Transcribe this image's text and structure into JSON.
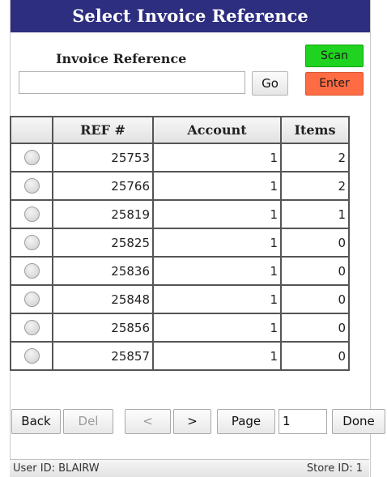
{
  "title": "Select Invoice Reference",
  "invoice": {
    "label": "Invoice Reference",
    "value": "",
    "go_label": "Go",
    "scan_label": "Scan",
    "enter_label": "Enter"
  },
  "colors": {
    "title_bar": "#2d2e80",
    "scan_button": "#21d321",
    "enter_button": "#ff6b43"
  },
  "table": {
    "headers": [
      "",
      "REF #",
      "Account",
      "Items"
    ],
    "rows": [
      {
        "ref": "25753",
        "account": "1",
        "items": "2"
      },
      {
        "ref": "25766",
        "account": "1",
        "items": "2"
      },
      {
        "ref": "25819",
        "account": "1",
        "items": "1"
      },
      {
        "ref": "25825",
        "account": "1",
        "items": "0"
      },
      {
        "ref": "25836",
        "account": "1",
        "items": "0"
      },
      {
        "ref": "25848",
        "account": "1",
        "items": "0"
      },
      {
        "ref": "25856",
        "account": "1",
        "items": "0"
      },
      {
        "ref": "25857",
        "account": "1",
        "items": "0"
      }
    ]
  },
  "pager": {
    "back_label": "Back",
    "del_label": "Del",
    "prev_label": "<",
    "next_label": ">",
    "page_label": "Page",
    "page_value": "1",
    "done_label": "Done"
  },
  "status": {
    "user": "User ID: BLAIRW",
    "store": "Store ID: 1"
  }
}
